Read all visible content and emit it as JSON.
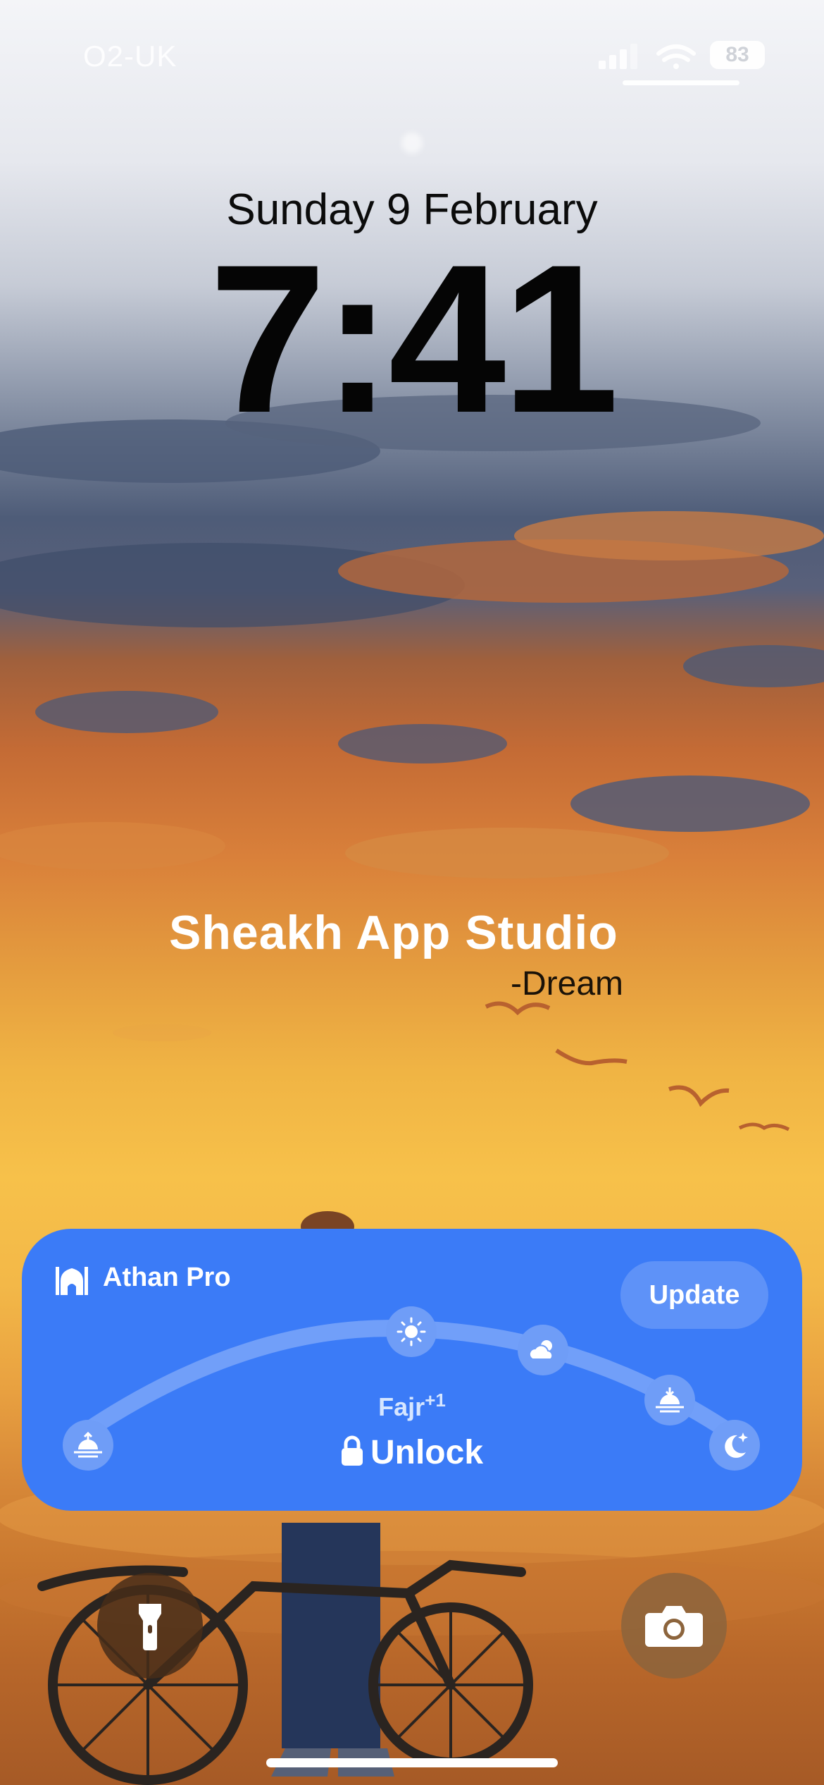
{
  "status_bar": {
    "carrier": "O2-UK",
    "battery": "83",
    "icons": [
      "signal-icon",
      "wifi-icon",
      "battery-icon"
    ]
  },
  "lock_screen": {
    "date": "Sunday 9 February",
    "time": "7:41"
  },
  "wallpaper": {
    "title": "Sheakh App Studio",
    "subtitle": "-Dream"
  },
  "widget": {
    "app_name": "Athan Pro",
    "update_label": "Update",
    "prayer_name": "Fajr",
    "prayer_suffix": "+1",
    "unlock_label": "Unlock",
    "background_color": "#3b7bf7",
    "icons": [
      "sunrise-icon",
      "sun-icon",
      "partly-cloudy-icon",
      "sunset-icon",
      "moon-stars-icon"
    ]
  },
  "quick_actions": {
    "left": "flashlight-icon",
    "right": "camera-icon"
  }
}
